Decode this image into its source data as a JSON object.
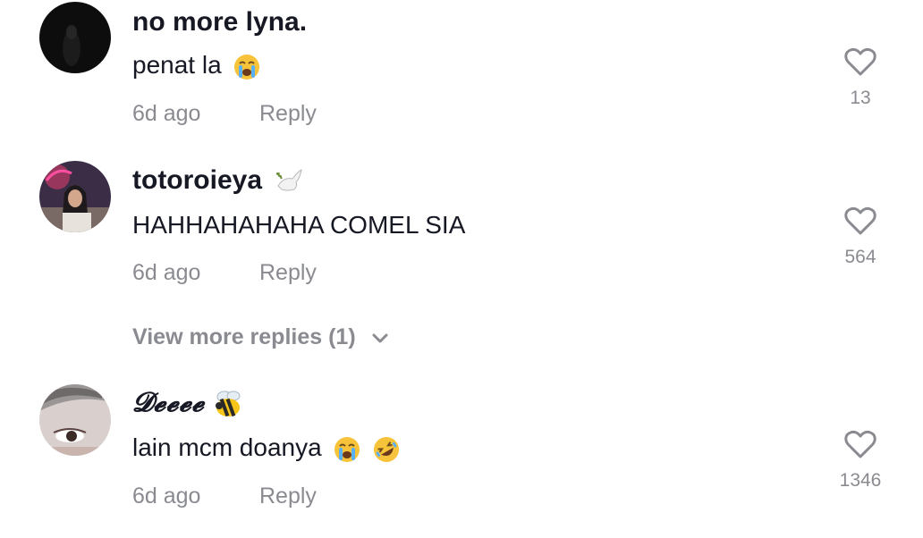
{
  "comments": [
    {
      "username": "no more lyna.",
      "text": "penat la",
      "emojis": [
        "loudly-crying-face"
      ],
      "time": "6d ago",
      "reply_label": "Reply",
      "likes": "13",
      "avatar_style": "dark"
    },
    {
      "username": "totoroieya",
      "username_emoji": "dove",
      "text": "HAHHAHAHAHA COMEL SIA",
      "emojis": [],
      "time": "6d ago",
      "reply_label": "Reply",
      "likes": "564",
      "avatar_style": "photo-neon"
    },
    {
      "username": "𝓓𝓮𝓮𝓮𝓮",
      "username_emoji": "bee",
      "text": "lain mcm doanya",
      "emojis": [
        "loudly-crying-face",
        "rolling-on-floor-laughing"
      ],
      "time": "6d ago",
      "reply_label": "Reply",
      "likes": "1346",
      "avatar_style": "face-closeup"
    }
  ],
  "view_more": "View more replies (1)",
  "colors": {
    "primary_text": "#161823",
    "secondary_text": "#8a8b91",
    "background": "#ffffff"
  }
}
